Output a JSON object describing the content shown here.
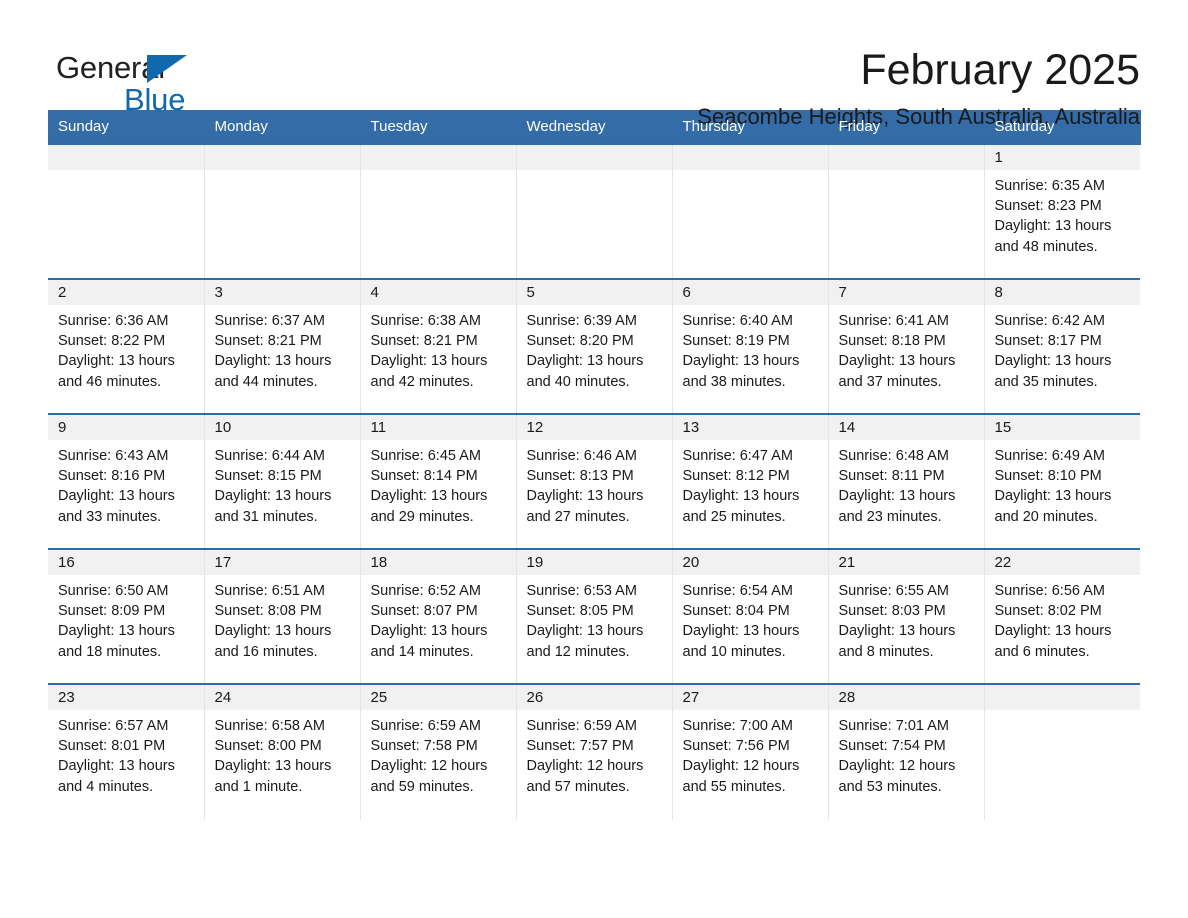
{
  "brand": {
    "name_top": "General",
    "name_bottom": "Blue",
    "triangle_icon": "blue-triangle-icon",
    "color_top": "#231f20",
    "color_bottom": "#1268ad"
  },
  "header": {
    "title": "February 2025",
    "subtitle": "Seacombe Heights, South Australia, Australia"
  },
  "colors": {
    "header_blue": "#336ca6",
    "row_divider_blue": "#2e6da4",
    "daynum_band": "#f1f1f1",
    "brand_blue": "#1268ad"
  },
  "calendar": {
    "weekday_headers": [
      "Sunday",
      "Monday",
      "Tuesday",
      "Wednesday",
      "Thursday",
      "Friday",
      "Saturday"
    ],
    "weeks": [
      [
        {
          "day": "",
          "sunrise": "",
          "sunset": "",
          "daylight_1": "",
          "daylight_2": ""
        },
        {
          "day": "",
          "sunrise": "",
          "sunset": "",
          "daylight_1": "",
          "daylight_2": ""
        },
        {
          "day": "",
          "sunrise": "",
          "sunset": "",
          "daylight_1": "",
          "daylight_2": ""
        },
        {
          "day": "",
          "sunrise": "",
          "sunset": "",
          "daylight_1": "",
          "daylight_2": ""
        },
        {
          "day": "",
          "sunrise": "",
          "sunset": "",
          "daylight_1": "",
          "daylight_2": ""
        },
        {
          "day": "",
          "sunrise": "",
          "sunset": "",
          "daylight_1": "",
          "daylight_2": ""
        },
        {
          "day": "1",
          "sunrise": "Sunrise: 6:35 AM",
          "sunset": "Sunset: 8:23 PM",
          "daylight_1": "Daylight: 13 hours",
          "daylight_2": "and 48 minutes."
        }
      ],
      [
        {
          "day": "2",
          "sunrise": "Sunrise: 6:36 AM",
          "sunset": "Sunset: 8:22 PM",
          "daylight_1": "Daylight: 13 hours",
          "daylight_2": "and 46 minutes."
        },
        {
          "day": "3",
          "sunrise": "Sunrise: 6:37 AM",
          "sunset": "Sunset: 8:21 PM",
          "daylight_1": "Daylight: 13 hours",
          "daylight_2": "and 44 minutes."
        },
        {
          "day": "4",
          "sunrise": "Sunrise: 6:38 AM",
          "sunset": "Sunset: 8:21 PM",
          "daylight_1": "Daylight: 13 hours",
          "daylight_2": "and 42 minutes."
        },
        {
          "day": "5",
          "sunrise": "Sunrise: 6:39 AM",
          "sunset": "Sunset: 8:20 PM",
          "daylight_1": "Daylight: 13 hours",
          "daylight_2": "and 40 minutes."
        },
        {
          "day": "6",
          "sunrise": "Sunrise: 6:40 AM",
          "sunset": "Sunset: 8:19 PM",
          "daylight_1": "Daylight: 13 hours",
          "daylight_2": "and 38 minutes."
        },
        {
          "day": "7",
          "sunrise": "Sunrise: 6:41 AM",
          "sunset": "Sunset: 8:18 PM",
          "daylight_1": "Daylight: 13 hours",
          "daylight_2": "and 37 minutes."
        },
        {
          "day": "8",
          "sunrise": "Sunrise: 6:42 AM",
          "sunset": "Sunset: 8:17 PM",
          "daylight_1": "Daylight: 13 hours",
          "daylight_2": "and 35 minutes."
        }
      ],
      [
        {
          "day": "9",
          "sunrise": "Sunrise: 6:43 AM",
          "sunset": "Sunset: 8:16 PM",
          "daylight_1": "Daylight: 13 hours",
          "daylight_2": "and 33 minutes."
        },
        {
          "day": "10",
          "sunrise": "Sunrise: 6:44 AM",
          "sunset": "Sunset: 8:15 PM",
          "daylight_1": "Daylight: 13 hours",
          "daylight_2": "and 31 minutes."
        },
        {
          "day": "11",
          "sunrise": "Sunrise: 6:45 AM",
          "sunset": "Sunset: 8:14 PM",
          "daylight_1": "Daylight: 13 hours",
          "daylight_2": "and 29 minutes."
        },
        {
          "day": "12",
          "sunrise": "Sunrise: 6:46 AM",
          "sunset": "Sunset: 8:13 PM",
          "daylight_1": "Daylight: 13 hours",
          "daylight_2": "and 27 minutes."
        },
        {
          "day": "13",
          "sunrise": "Sunrise: 6:47 AM",
          "sunset": "Sunset: 8:12 PM",
          "daylight_1": "Daylight: 13 hours",
          "daylight_2": "and 25 minutes."
        },
        {
          "day": "14",
          "sunrise": "Sunrise: 6:48 AM",
          "sunset": "Sunset: 8:11 PM",
          "daylight_1": "Daylight: 13 hours",
          "daylight_2": "and 23 minutes."
        },
        {
          "day": "15",
          "sunrise": "Sunrise: 6:49 AM",
          "sunset": "Sunset: 8:10 PM",
          "daylight_1": "Daylight: 13 hours",
          "daylight_2": "and 20 minutes."
        }
      ],
      [
        {
          "day": "16",
          "sunrise": "Sunrise: 6:50 AM",
          "sunset": "Sunset: 8:09 PM",
          "daylight_1": "Daylight: 13 hours",
          "daylight_2": "and 18 minutes."
        },
        {
          "day": "17",
          "sunrise": "Sunrise: 6:51 AM",
          "sunset": "Sunset: 8:08 PM",
          "daylight_1": "Daylight: 13 hours",
          "daylight_2": "and 16 minutes."
        },
        {
          "day": "18",
          "sunrise": "Sunrise: 6:52 AM",
          "sunset": "Sunset: 8:07 PM",
          "daylight_1": "Daylight: 13 hours",
          "daylight_2": "and 14 minutes."
        },
        {
          "day": "19",
          "sunrise": "Sunrise: 6:53 AM",
          "sunset": "Sunset: 8:05 PM",
          "daylight_1": "Daylight: 13 hours",
          "daylight_2": "and 12 minutes."
        },
        {
          "day": "20",
          "sunrise": "Sunrise: 6:54 AM",
          "sunset": "Sunset: 8:04 PM",
          "daylight_1": "Daylight: 13 hours",
          "daylight_2": "and 10 minutes."
        },
        {
          "day": "21",
          "sunrise": "Sunrise: 6:55 AM",
          "sunset": "Sunset: 8:03 PM",
          "daylight_1": "Daylight: 13 hours",
          "daylight_2": "and 8 minutes."
        },
        {
          "day": "22",
          "sunrise": "Sunrise: 6:56 AM",
          "sunset": "Sunset: 8:02 PM",
          "daylight_1": "Daylight: 13 hours",
          "daylight_2": "and 6 minutes."
        }
      ],
      [
        {
          "day": "23",
          "sunrise": "Sunrise: 6:57 AM",
          "sunset": "Sunset: 8:01 PM",
          "daylight_1": "Daylight: 13 hours",
          "daylight_2": "and 4 minutes."
        },
        {
          "day": "24",
          "sunrise": "Sunrise: 6:58 AM",
          "sunset": "Sunset: 8:00 PM",
          "daylight_1": "Daylight: 13 hours",
          "daylight_2": "and 1 minute."
        },
        {
          "day": "25",
          "sunrise": "Sunrise: 6:59 AM",
          "sunset": "Sunset: 7:58 PM",
          "daylight_1": "Daylight: 12 hours",
          "daylight_2": "and 59 minutes."
        },
        {
          "day": "26",
          "sunrise": "Sunrise: 6:59 AM",
          "sunset": "Sunset: 7:57 PM",
          "daylight_1": "Daylight: 12 hours",
          "daylight_2": "and 57 minutes."
        },
        {
          "day": "27",
          "sunrise": "Sunrise: 7:00 AM",
          "sunset": "Sunset: 7:56 PM",
          "daylight_1": "Daylight: 12 hours",
          "daylight_2": "and 55 minutes."
        },
        {
          "day": "28",
          "sunrise": "Sunrise: 7:01 AM",
          "sunset": "Sunset: 7:54 PM",
          "daylight_1": "Daylight: 12 hours",
          "daylight_2": "and 53 minutes."
        },
        {
          "day": "",
          "sunrise": "",
          "sunset": "",
          "daylight_1": "",
          "daylight_2": ""
        }
      ]
    ]
  }
}
